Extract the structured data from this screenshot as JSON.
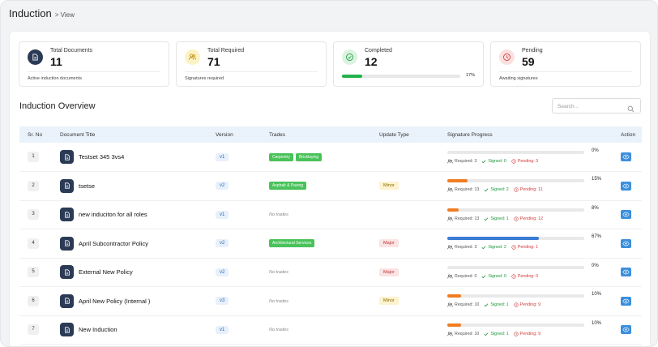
{
  "header": {
    "title": "Induction",
    "breadcrumb": "> View"
  },
  "cards": [
    {
      "label": "Total Documents",
      "value": "11",
      "sub": "Active induction documents",
      "icon": "document-icon",
      "bg": "#2b3a55",
      "fg": "#ffffff"
    },
    {
      "label": "Total Required",
      "value": "71",
      "sub": "Signatures required",
      "icon": "users-icon",
      "bg": "#fdf2c4",
      "fg": "#b8860b"
    },
    {
      "label": "Completed",
      "value": "12",
      "progress": "17%",
      "progress_fraction": 0.17,
      "icon": "check-circle-icon",
      "bg": "#dcf3e1",
      "fg": "#1a9a3a"
    },
    {
      "label": "Pending",
      "value": "59",
      "sub": "Awaiting signatures",
      "icon": "clock-icon",
      "bg": "#fbe0e0",
      "fg": "#d23a3a"
    }
  ],
  "overview": {
    "title": "Induction Overview",
    "search_placeholder": "Search..."
  },
  "table": {
    "columns": [
      "Sr. No",
      "Document Title",
      "Version",
      "Trades",
      "Update Type",
      "Signature Progress",
      "Action"
    ],
    "rows": [
      {
        "no": "1",
        "title": "Testset 345 3vs4",
        "version": "v1",
        "trades": [
          "Carpentry",
          "Bricklaying"
        ],
        "update": "",
        "progress": 0,
        "pct": "0%",
        "required": "Required: 3",
        "signed": "Signed: 0",
        "pending": "Pending: 3"
      },
      {
        "no": "2",
        "title": "tsetse",
        "version": "v2",
        "trades": [
          "Asphalt & Paving"
        ],
        "update": "Minor",
        "progress": 0.15,
        "pct": "15%",
        "required": "Required: 13",
        "signed": "Signed: 2",
        "pending": "Pending: 11"
      },
      {
        "no": "3",
        "title": "new induciton for all roles",
        "version": "v1",
        "trades": [],
        "update": "",
        "progress": 0.08,
        "pct": "8%",
        "required": "Required: 13",
        "signed": "Signed: 1",
        "pending": "Pending: 12"
      },
      {
        "no": "4",
        "title": "April Subcontractor Policy",
        "version": "v2",
        "trades": [
          "Architectural Services"
        ],
        "update": "Major",
        "progress": 0.67,
        "pct": "67%",
        "required": "Required: 3",
        "signed": "Signed: 2",
        "pending": "Pending: 1"
      },
      {
        "no": "5",
        "title": "External New Policy",
        "version": "v2",
        "trades": [],
        "update": "Major",
        "progress": 0,
        "pct": "0%",
        "required": "Required: 0",
        "signed": "Signed: 0",
        "pending": "Pending: 0"
      },
      {
        "no": "6",
        "title": "April New Policy (Internal )",
        "version": "v3",
        "trades": [],
        "update": "Minor",
        "progress": 0.1,
        "pct": "10%",
        "required": "Required: 10",
        "signed": "Signed: 1",
        "pending": "Pending: 9"
      },
      {
        "no": "7",
        "title": "New Induction",
        "version": "v1",
        "trades": [],
        "update": "",
        "progress": 0.1,
        "pct": "10%",
        "required": "Required: 10",
        "signed": "Signed: 1",
        "pending": "Pending: 9"
      }
    ],
    "no_trades_label": "No trades"
  },
  "colors": {
    "progress_low": "#f07d22",
    "progress_high": "#3a7bd5",
    "completed_bar": "#22b24c",
    "action": "#3b8fdc",
    "accent_dark": "#2b3a55"
  }
}
